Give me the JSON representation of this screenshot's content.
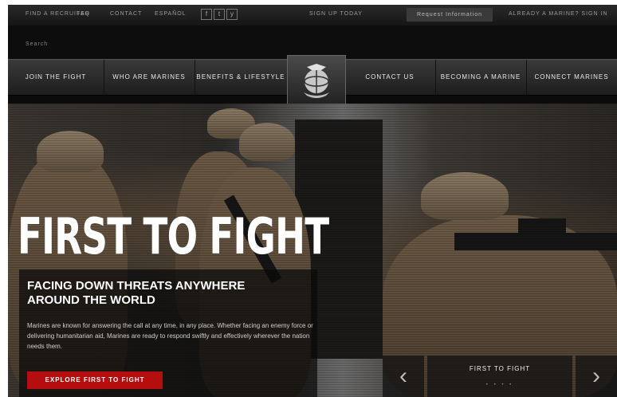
{
  "utility": {
    "links": [
      "Find a Recruiter",
      "FAQ",
      "Contact",
      "Español"
    ],
    "center_link": "Sign Up Today",
    "request_button": "Request Information",
    "right_link": "Already a Marine? Sign In"
  },
  "social": [
    "f",
    "t",
    "y"
  ],
  "search": {
    "label": "Search"
  },
  "nav": {
    "items_left": [
      "Join the Fight",
      "Who Are Marines",
      "Benefits & Lifestyle"
    ],
    "items_right": [
      "Contact Us",
      "Becoming a Marine",
      "Connect Marines"
    ]
  },
  "hero": {
    "headline": "FIRST TO FIGHT",
    "subhead": "Facing Down Threats Anywhere Around the World",
    "body": "Marines are known for answering the call at any time, in any place. Whether facing an enemy force or delivering humanitarian aid, Marines are ready to respond swiftly and effectively wherever the nation needs them.",
    "cta": "EXPLORE FIRST TO FIGHT"
  },
  "slider": {
    "title": "FIRST TO FIGHT",
    "prev": "‹",
    "next": "›",
    "dots": "• • • •"
  },
  "colors": {
    "accent": "#b40e0e",
    "background": "#0b0b0b"
  },
  "icons": [
    "facebook-icon",
    "twitter-icon",
    "youtube-icon",
    "usmc-emblem-icon",
    "chevron-left-icon",
    "chevron-right-icon"
  ]
}
